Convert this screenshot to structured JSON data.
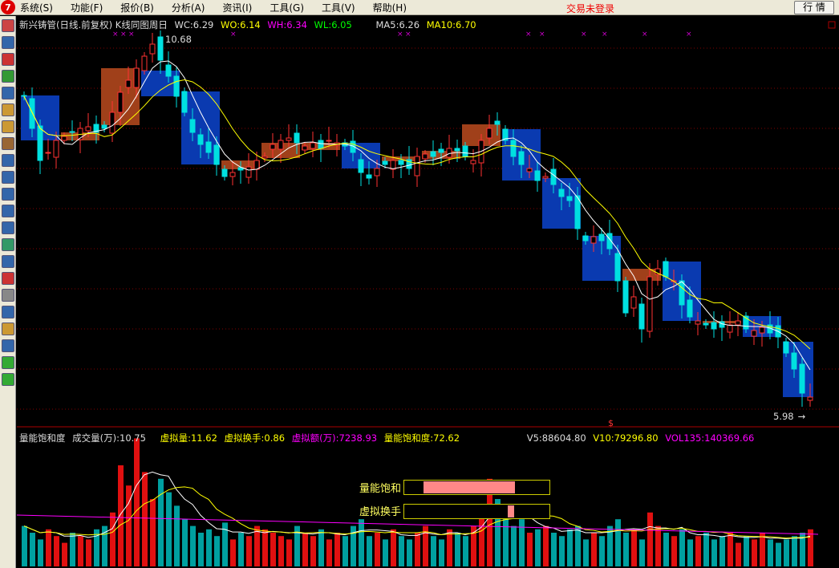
{
  "menu": {
    "logo": "7",
    "items": [
      "系统(S)",
      "功能(F)",
      "报价(B)",
      "分析(A)",
      "资讯(I)",
      "工具(G)",
      "工具(V)",
      "帮助(H)"
    ],
    "trade_status": "交易未登录",
    "quote_button": "行 情"
  },
  "main_info": {
    "title": "新兴铸管(日线.前复权) K线同图周日",
    "wc": "WC:6.29",
    "wo": "WO:6.14",
    "wh": "WH:6.34",
    "wl": "WL:6.05",
    "ma5": "MA5:6.26",
    "ma10": "MA10:6.70"
  },
  "price_labels": {
    "high": "10.68",
    "low": "5.98"
  },
  "sub_info": {
    "title": "量能饱和度",
    "vol": "成交量(万):10.75",
    "vvol": "虚拟量:11.62",
    "vturn": "虚拟换手:0.86",
    "vamt": "虚拟额(万):7238.93",
    "sat": "量能饱和度:72.62",
    "v5": "V5:88604.80",
    "v10": "V10:79296.80",
    "vol135": "VOL135:140369.66"
  },
  "overlay": {
    "sat_label": "量能饱和",
    "sat_fill": 0.7262,
    "turn_label": "虚拟换手",
    "turn_marker": 0.5
  },
  "colors": {
    "up": "#ff3232",
    "down": "#00e0e0",
    "week_up": "#a0401a",
    "week_down": "#0a3ab0",
    "ma5": "#ffffff",
    "ma10": "#ffff00",
    "vol135": "#ff00ff",
    "grid": "#800000"
  },
  "chart_data": {
    "type": "candlestick",
    "price_range": [
      5.9,
      10.75
    ],
    "closes": [
      9.96,
      9.56,
      9.16,
      9.26,
      9.41,
      9.46,
      9.51,
      9.56,
      9.58,
      9.51,
      9.56,
      9.76,
      10.01,
      10.16,
      10.31,
      10.46,
      10.61,
      10.41,
      10.21,
      9.96,
      9.76,
      9.51,
      9.36,
      9.26,
      9.11,
      8.96,
      9.01,
      9.04,
      9.08,
      9.16,
      9.21,
      9.36,
      9.41,
      9.44,
      9.38,
      9.34,
      9.38,
      9.31,
      9.41,
      9.38,
      9.34,
      9.26,
      9.01,
      8.94,
      9.06,
      9.11,
      9.16,
      9.11,
      9.06,
      9.21,
      9.24,
      9.21,
      9.26,
      9.31,
      9.28,
      9.21,
      9.16,
      9.41,
      9.56,
      9.61,
      9.41,
      9.21,
      9.11,
      9.06,
      8.91,
      8.96,
      8.86,
      8.71,
      8.66,
      8.31,
      8.16,
      8.21,
      8.16,
      8.06,
      7.66,
      7.26,
      7.46,
      7.06,
      7.71,
      7.81,
      7.71,
      7.66,
      7.36,
      7.21,
      7.16,
      7.11,
      7.06,
      7.08,
      7.11,
      7.16,
      7.06,
      7.04,
      7.08,
      7.01,
      6.96,
      6.76,
      6.56,
      6.26,
      6.21
    ],
    "volumes": [
      12,
      10,
      8,
      11,
      9,
      7,
      10,
      9,
      8,
      11,
      12,
      16,
      30,
      24,
      38,
      28,
      20,
      26,
      22,
      18,
      14,
      12,
      10,
      11,
      9,
      13,
      8,
      10,
      9,
      12,
      11,
      10,
      9,
      8,
      12,
      10,
      9,
      11,
      8,
      10,
      9,
      12,
      14,
      9,
      10,
      8,
      11,
      9,
      8,
      10,
      12,
      9,
      8,
      11,
      10,
      9,
      12,
      16,
      26,
      20,
      18,
      12,
      14,
      10,
      11,
      12,
      10,
      9,
      11,
      12,
      8,
      10,
      9,
      12,
      14,
      10,
      11,
      8,
      16,
      12,
      10,
      9,
      11,
      8,
      9,
      10,
      8,
      9,
      10,
      7,
      9,
      8,
      10,
      8,
      7,
      8,
      9,
      10,
      11
    ]
  }
}
